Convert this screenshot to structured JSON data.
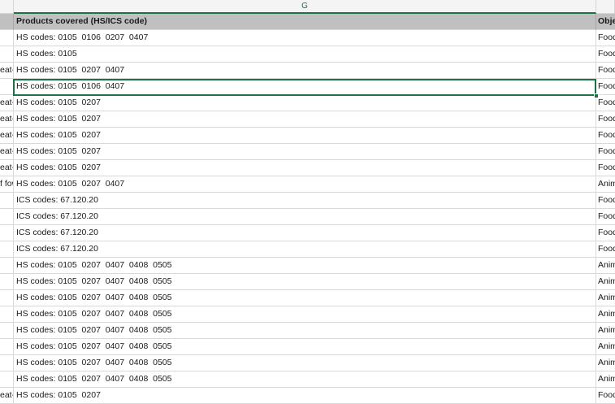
{
  "column_header": {
    "label": "G"
  },
  "header_row": {
    "left": "",
    "center": "Products covered (HS/ICS code)",
    "right": "Obje"
  },
  "rows": [
    {
      "left": "",
      "center": "HS codes: 0105  0106  0207  0407",
      "right": "Food"
    },
    {
      "left": "",
      "center": "HS codes: 0105",
      "right": "Food"
    },
    {
      "left": "eat-ty",
      "center": "HS codes: 0105  0207  0407",
      "right": "Food"
    },
    {
      "left": "",
      "center": "HS codes: 0105  0106  0407",
      "right": "Food"
    },
    {
      "left": "eat-ty",
      "center": "HS codes: 0105  0207",
      "right": "Food"
    },
    {
      "left": "eat-ty",
      "center": "HS codes: 0105  0207",
      "right": "Food"
    },
    {
      "left": "eat-ty",
      "center": "HS codes: 0105  0207",
      "right": "Food"
    },
    {
      "left": "eat-ty",
      "center": "HS codes: 0105  0207",
      "right": "Food"
    },
    {
      "left": "eat-ty",
      "center": "HS codes: 0105  0207",
      "right": "Food"
    },
    {
      "left": "f fow",
      "center": "HS codes: 0105  0207  0407",
      "right": "Anim"
    },
    {
      "left": "",
      "center": "ICS codes: 67.120.20",
      "right": "Food"
    },
    {
      "left": "",
      "center": "ICS codes: 67.120.20",
      "right": "Food"
    },
    {
      "left": "",
      "center": "ICS codes: 67.120.20",
      "right": "Food"
    },
    {
      "left": "",
      "center": "ICS codes: 67.120.20",
      "right": "Food"
    },
    {
      "left": "",
      "center": "HS codes: 0105  0207  0407  0408  0505",
      "right": "Anim"
    },
    {
      "left": "",
      "center": "HS codes: 0105  0207  0407  0408  0505",
      "right": "Anim"
    },
    {
      "left": "",
      "center": "HS codes: 0105  0207  0407  0408  0505",
      "right": "Anim"
    },
    {
      "left": "",
      "center": "HS codes: 0105  0207  0407  0408  0505",
      "right": "Anim"
    },
    {
      "left": "",
      "center": "HS codes: 0105  0207  0407  0408  0505",
      "right": "Anim"
    },
    {
      "left": "",
      "center": "HS codes: 0105  0207  0407  0408  0505",
      "right": "Anim"
    },
    {
      "left": "",
      "center": "HS codes: 0105  0207  0407  0408  0505",
      "right": "Anim"
    },
    {
      "left": "",
      "center": "HS codes: 0105  0207  0407  0408  0505",
      "right": "Anim"
    },
    {
      "left": "eat-ty",
      "center": "HS codes: 0105  0207",
      "right": "Food"
    }
  ],
  "selected_row_index": 3,
  "colors": {
    "accent": "#1e7145",
    "header_bg": "#c0c0c0",
    "gridline": "#d9d9d9"
  }
}
